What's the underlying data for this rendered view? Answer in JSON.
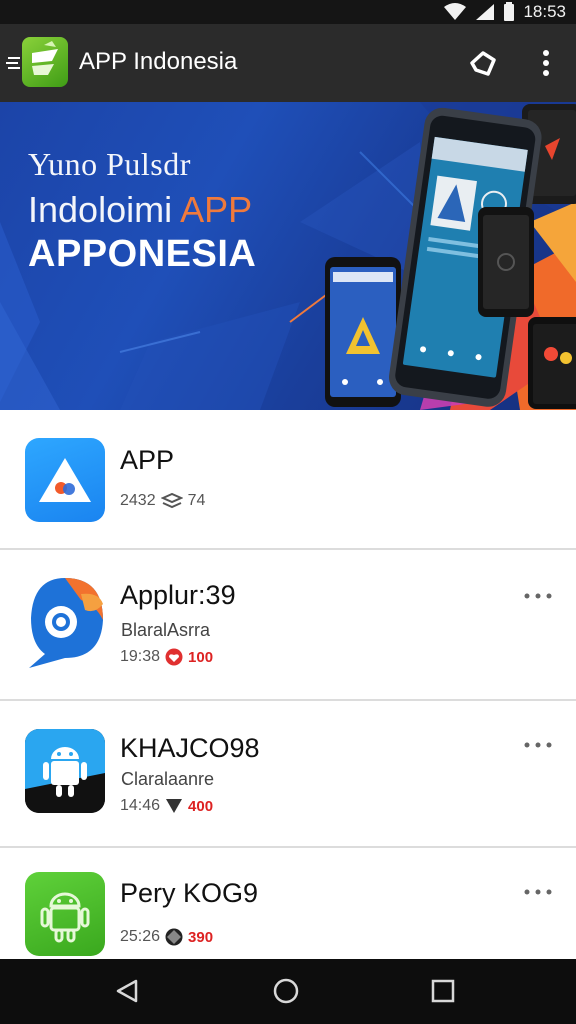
{
  "status_bar": {
    "time": "18:53"
  },
  "app_bar": {
    "title": "APP Indonesia"
  },
  "banner": {
    "line1": "Yuno Pulsdr",
    "line2": "Indoloimi",
    "line2_accent": "APP",
    "line3": "APPONESIA"
  },
  "apps": [
    {
      "name": "APP",
      "subtitle": "",
      "meta_left": "2432",
      "meta_right": "74",
      "icon": "triangle-app-icon"
    },
    {
      "name": "Applur:39",
      "subtitle": "BlaralAsrra",
      "meta_left": "19:38",
      "meta_right": "100",
      "icon": "chat-bubble-app-icon"
    },
    {
      "name": "KHAJCO98",
      "subtitle": "Claralaanre",
      "meta_left": "14:46",
      "meta_right": "400",
      "icon": "android-app-icon"
    },
    {
      "name": "Pery KOG9",
      "subtitle": "",
      "meta_left": "25:26",
      "meta_right": "390",
      "icon": "android-outline-app-icon"
    }
  ],
  "colors": {
    "app_bar": "#2b2b2b",
    "banner_blue": "#1f4fb8",
    "accent_orange": "#f07a3c",
    "badge_red": "#d22222"
  }
}
